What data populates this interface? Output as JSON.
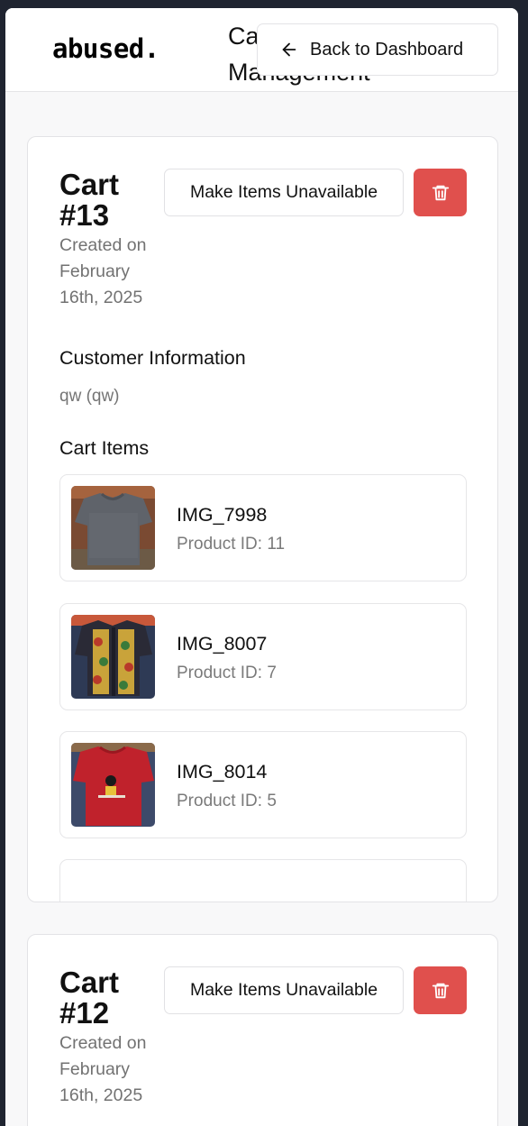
{
  "header": {
    "logo": "abused.",
    "title": "Cart Management",
    "back_label": "Back to Dashboard"
  },
  "carts": [
    {
      "title": "Cart #13",
      "created": "Created on February 16th, 2025",
      "unavailable_label": "Make Items Unavailable",
      "customer_heading": "Customer Information",
      "customer": "qw (qw)",
      "items_heading": "Cart Items",
      "items": [
        {
          "name": "IMG_7998",
          "product_id": "Product ID: 11",
          "image": "grey-tshirt-photo"
        },
        {
          "name": "IMG_8007",
          "product_id": "Product ID: 7",
          "image": "patterned-shirt-photo"
        },
        {
          "name": "IMG_8014",
          "product_id": "Product ID: 5",
          "image": "red-shirt-photo"
        }
      ]
    },
    {
      "title": "Cart #12",
      "created": "Created on February 16th, 2025",
      "unavailable_label": "Make Items Unavailable"
    }
  ],
  "colors": {
    "delete": "#e0504d",
    "muted_text": "#757575",
    "border": "#e3e3e6"
  },
  "icons": {
    "back": "arrow-left-icon",
    "delete": "trash-icon"
  }
}
